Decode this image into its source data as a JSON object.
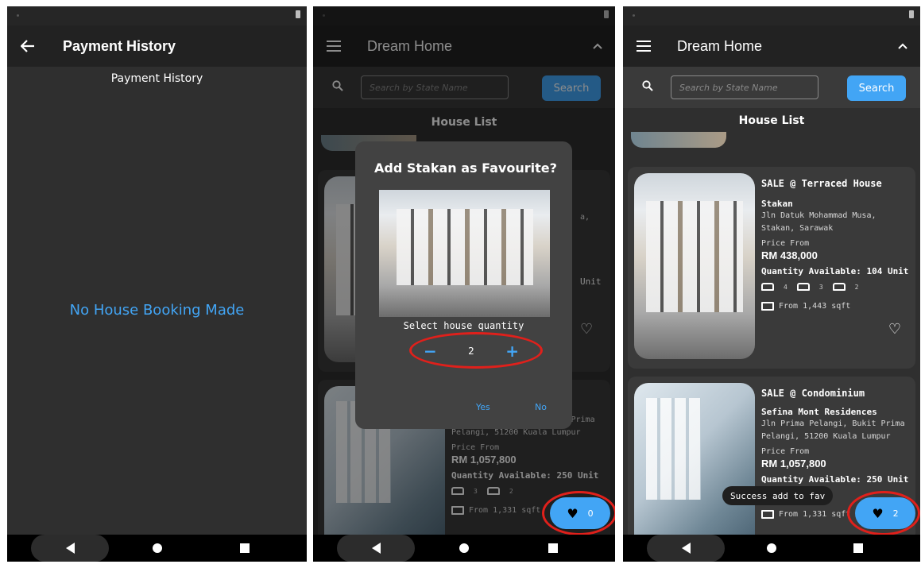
{
  "screen1": {
    "appbar_title": "Payment History",
    "subtitle": "Payment History",
    "empty_message": "No House Booking Made"
  },
  "screen2": {
    "appbar_title": "Dream Home",
    "search_placeholder": "Search by State Name",
    "search_button": "Search",
    "list_title": "House List",
    "card1": {
      "qty_suffix": "Unit",
      "addr_fragment": "a,"
    },
    "card2": {
      "addr_line1": "Jln Prima Pelangi, Bukit Prima",
      "addr_line2": "Pelangi, 51200 Kuala Lumpur",
      "price_from": "Price From",
      "price": "RM 1,057,800",
      "qty": "Quantity Available: 250 Unit",
      "beds": "3",
      "baths": "2",
      "sqft": "From 1,331 sqft"
    },
    "dialog": {
      "title": "Add Stakan as Favourite?",
      "label": "Select house quantity",
      "minus": "−",
      "value": "2",
      "plus": "+",
      "yes": "Yes",
      "no": "No"
    },
    "fab_count": "0"
  },
  "screen3": {
    "appbar_title": "Dream Home",
    "search_placeholder": "Search by State Name",
    "search_button": "Search",
    "list_title": "House List",
    "card1": {
      "type": "SALE @ Terraced House",
      "name": "Stakan",
      "addr_line1": "Jln Datuk Mohammad Musa,",
      "addr_line2": "Stakan, Sarawak",
      "price_from": "Price From",
      "price": "RM 438,000",
      "qty": "Quantity Available: 104 Unit",
      "beds": "4",
      "baths": "3",
      "cars": "2",
      "sqft": "From 1,443 sqft"
    },
    "card2": {
      "type": "SALE @ Condominium",
      "name": "Sefina Mont Residences",
      "addr_line1": "Jln Prima Pelangi, Bukit Prima",
      "addr_line2": "Pelangi, 51200 Kuala Lumpur",
      "price_from": "Price From",
      "price": "RM 1,057,800",
      "qty": "Quantity Available: 250 Unit",
      "beds": "3",
      "baths": "2",
      "sqft": "From 1,331 sqft"
    },
    "toast": "Success add to fav",
    "fab_count": "2"
  },
  "colors": {
    "accent": "#42a5f5",
    "highlight": "#e0201b",
    "background": "#2f2f2f",
    "appbar": "#222222"
  },
  "icons": [
    "back-arrow-icon",
    "menu-icon",
    "chevron-up-icon",
    "search-icon",
    "heart-icon",
    "bed-icon",
    "bath-icon",
    "car-icon",
    "area-icon"
  ]
}
